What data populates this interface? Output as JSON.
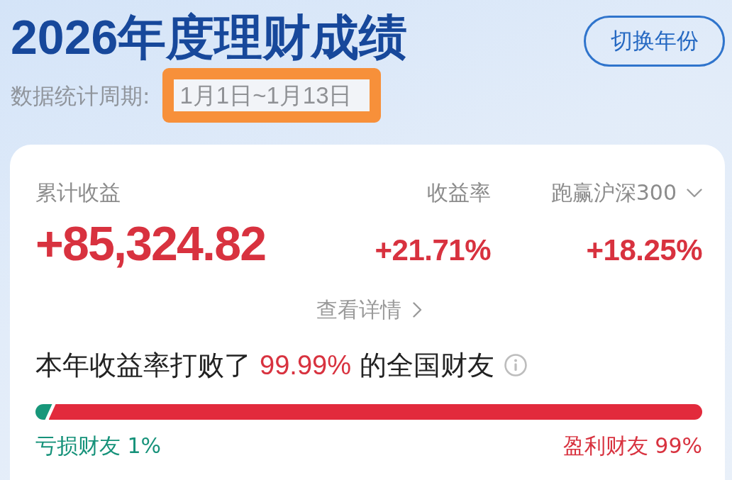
{
  "header": {
    "title": "2026年度理财成绩",
    "period_label": "数据统计周期:",
    "period": "1月1日~1月13日",
    "period_highlighted": true,
    "switch_button": "切换年份"
  },
  "summary": {
    "stats": [
      {
        "kind": "primary",
        "label": "累计收益",
        "value": "+85,324.82"
      },
      {
        "kind": "secondary",
        "label": "收益率",
        "value": "+21.71%"
      },
      {
        "kind": "dropdown",
        "label": "跑赢沪深300",
        "value": "+18.25%"
      }
    ],
    "details_link": "查看详情"
  },
  "ranking": {
    "sentence": [
      {
        "kind": "plain",
        "text": "本年收益率打败了"
      },
      {
        "kind": "highlight",
        "text": "99.99%"
      },
      {
        "kind": "plain",
        "text": "的全国财友"
      }
    ],
    "level": 0.025,
    "loss_label": "亏损财友 1%",
    "gain_label": "盈利财友 99%"
  }
}
